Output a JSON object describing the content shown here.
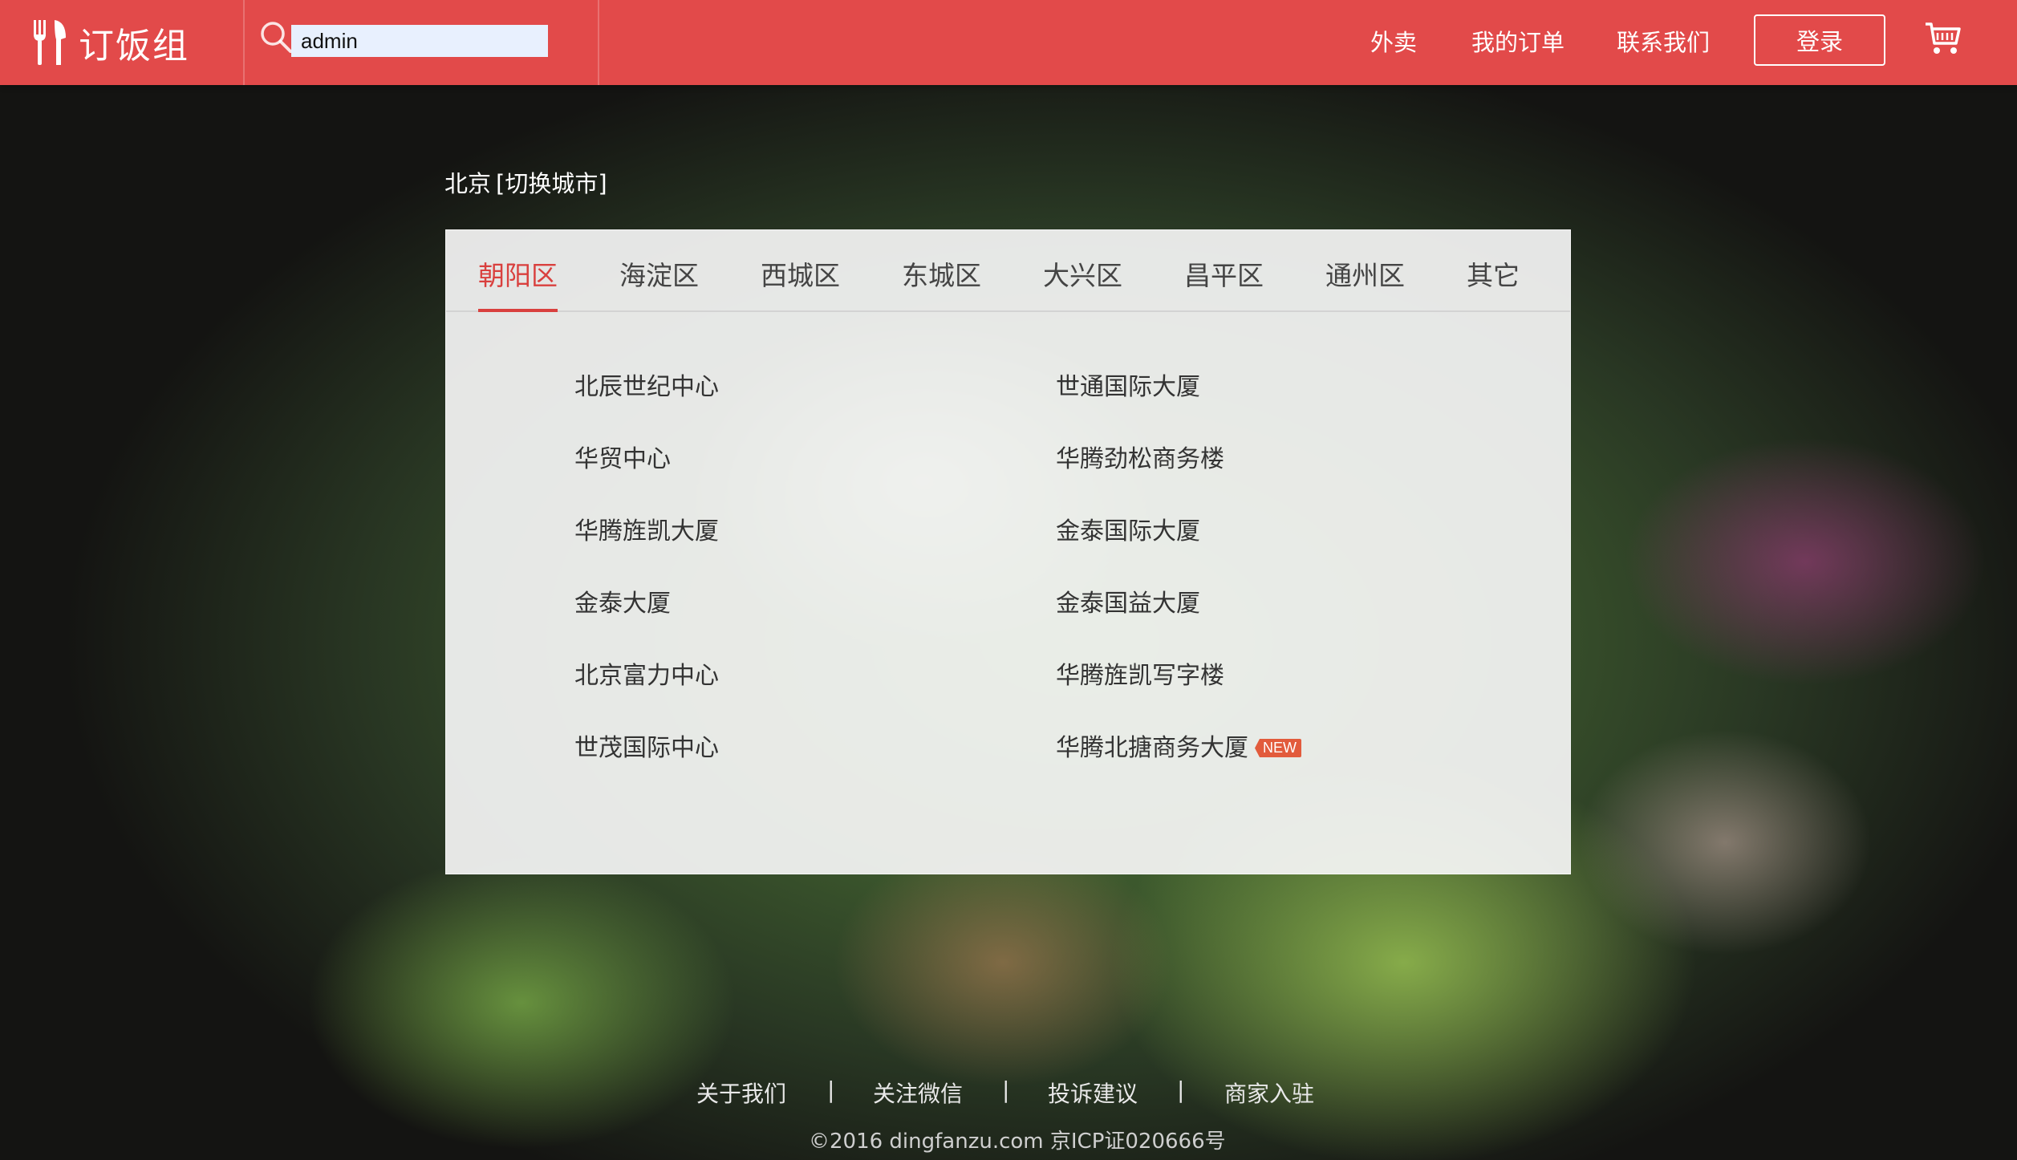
{
  "header": {
    "logo_text": "订饭组",
    "search": {
      "value": "admin",
      "placeholder": ""
    },
    "nav": {
      "takeout": "外卖",
      "my_orders": "我的订单",
      "contact_us": "联系我们"
    },
    "login_label": "登录"
  },
  "city": {
    "name": "北京",
    "switch_label": "[切换城市]"
  },
  "districts": {
    "tabs": [
      "朝阳区",
      "海淀区",
      "西城区",
      "东城区",
      "大兴区",
      "昌平区",
      "通州区",
      "其它"
    ],
    "active_tab": "朝阳区",
    "buildings": [
      {
        "name": "北辰世纪中心"
      },
      {
        "name": "世通国际大厦"
      },
      {
        "name": "华贸中心"
      },
      {
        "name": "华腾劲松商务楼"
      },
      {
        "name": "华腾旌凯大厦"
      },
      {
        "name": "金泰国际大厦"
      },
      {
        "name": "金泰大厦"
      },
      {
        "name": "金泰国益大厦"
      },
      {
        "name": "北京富力中心"
      },
      {
        "name": "华腾旌凯写字楼"
      },
      {
        "name": "世茂国际中心"
      },
      {
        "name": "华腾北搪商务大厦",
        "badge": "NEW"
      }
    ]
  },
  "footer": {
    "links": [
      "关于我们",
      "关注微信",
      "投诉建议",
      "商家入驻"
    ],
    "separator": "|",
    "copyright": "©2016 dingfanzu.com 京ICP证020666号"
  },
  "colors": {
    "brand_red": "#e24a4a",
    "active_tab": "#d9403e",
    "new_badge": "#e25b3c"
  },
  "icons": [
    "fork-knife-logo-icon",
    "search-icon",
    "cart-icon"
  ]
}
